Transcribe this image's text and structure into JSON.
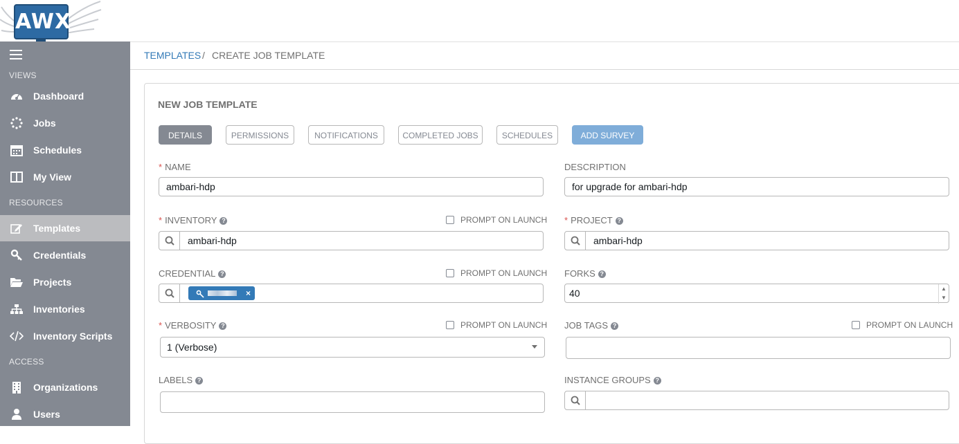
{
  "header": {
    "logo_text": "AWX"
  },
  "sidebar": {
    "sections": [
      "VIEWS",
      "RESOURCES",
      "ACCESS"
    ],
    "items": [
      {
        "label": "Dashboard",
        "icon": "dashboard-icon"
      },
      {
        "label": "Jobs",
        "icon": "spinner-icon"
      },
      {
        "label": "Schedules",
        "icon": "calendar-icon"
      },
      {
        "label": "My View",
        "icon": "columns-icon"
      },
      {
        "label": "Templates",
        "icon": "edit-icon",
        "active": true
      },
      {
        "label": "Credentials",
        "icon": "key-icon"
      },
      {
        "label": "Projects",
        "icon": "folder-icon"
      },
      {
        "label": "Inventories",
        "icon": "sitemap-icon"
      },
      {
        "label": "Inventory Scripts",
        "icon": "code-icon"
      },
      {
        "label": "Organizations",
        "icon": "building-icon"
      },
      {
        "label": "Users",
        "icon": "user-icon"
      }
    ]
  },
  "breadcrumb": {
    "parent": "TEMPLATES",
    "separator": "/",
    "current": "CREATE JOB TEMPLATE"
  },
  "panel": {
    "title": "NEW JOB TEMPLATE",
    "tabs": [
      "DETAILS",
      "PERMISSIONS",
      "NOTIFICATIONS",
      "COMPLETED JOBS",
      "SCHEDULES",
      "ADD SURVEY"
    ],
    "active_tab": "DETAILS"
  },
  "form": {
    "prompt_label": "PROMPT ON LAUNCH",
    "name": {
      "label": "NAME",
      "value": "ambari-hdp"
    },
    "description": {
      "label": "DESCRIPTION",
      "value": "for upgrade for ambari-hdp"
    },
    "inventory": {
      "label": "INVENTORY",
      "value": "ambari-hdp"
    },
    "project": {
      "label": "PROJECT",
      "value": "ambari-hdp"
    },
    "credential": {
      "label": "CREDENTIAL"
    },
    "forks": {
      "label": "FORKS",
      "value": "40"
    },
    "verbosity": {
      "label": "VERBOSITY",
      "value": "1 (Verbose)"
    },
    "job_tags": {
      "label": "JOB TAGS",
      "value": ""
    },
    "labels": {
      "label": "LABELS",
      "value": ""
    },
    "instance_groups": {
      "label": "INSTANCE GROUPS",
      "value": ""
    }
  },
  "colors": {
    "sidebar_bg": "#848992",
    "accent": "#337ab7",
    "required": "#d9534f",
    "survey_button": "#7fadd9"
  }
}
